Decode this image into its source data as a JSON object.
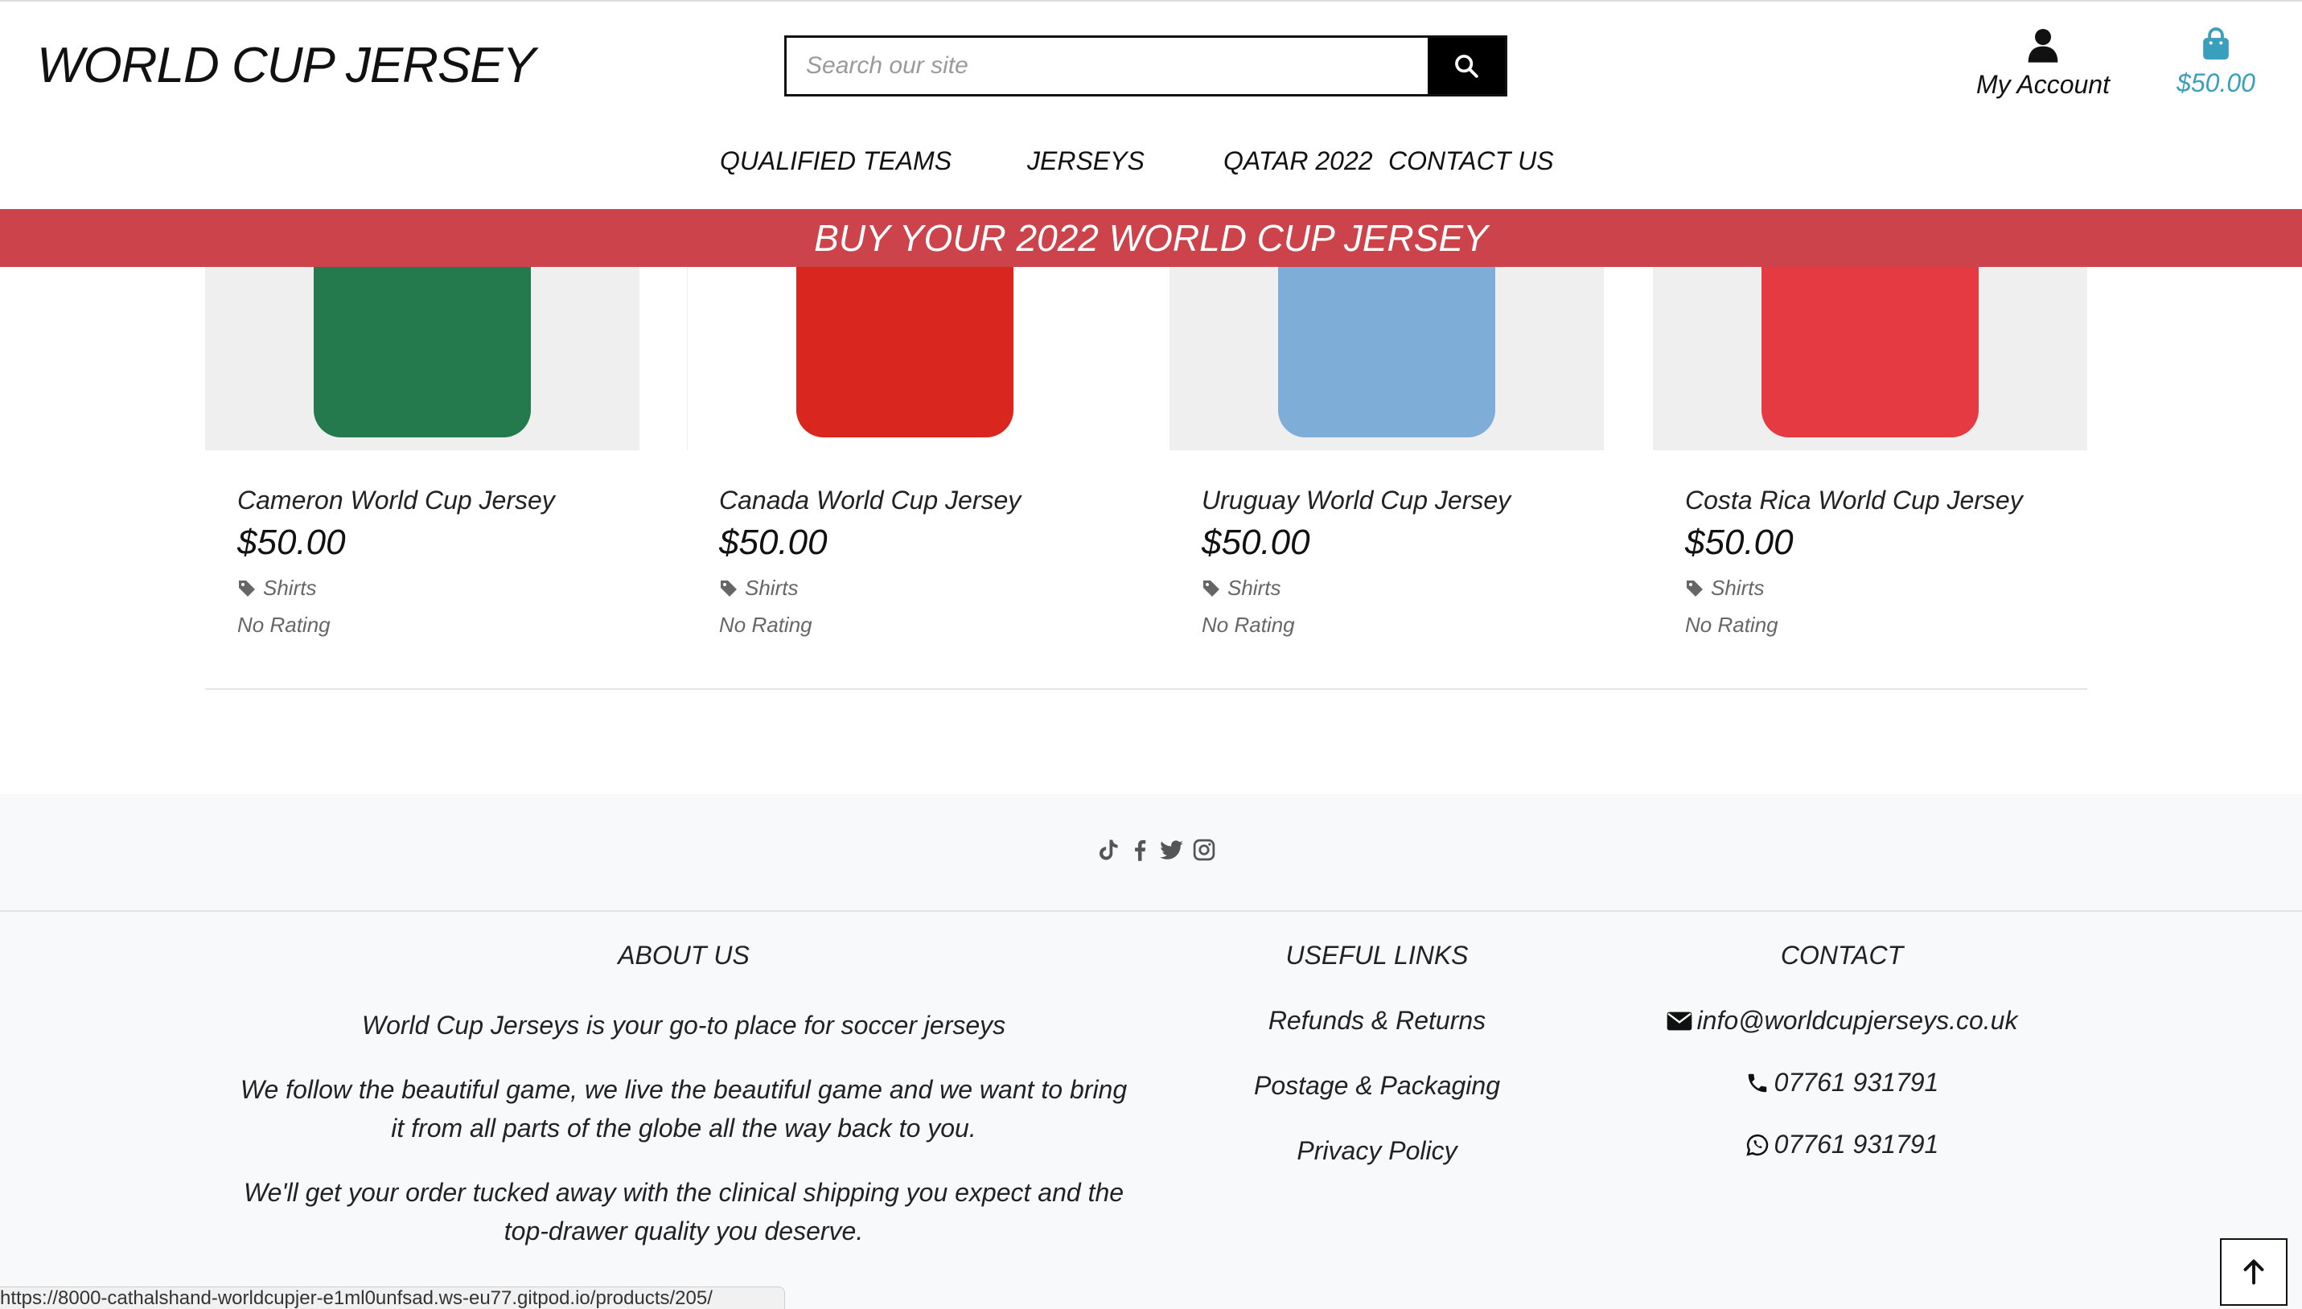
{
  "header": {
    "logo": "WORLD CUP JERSEY",
    "search_placeholder": "Search our site",
    "account_label": "My Account",
    "cart_total": "$50.00"
  },
  "nav": {
    "items": [
      "QUALIFIED TEAMS",
      "JERSEYS",
      "QATAR 2022",
      "CONTACT US"
    ]
  },
  "banner": {
    "text": "BUY YOUR 2022 WORLD CUP JERSEY"
  },
  "products": [
    {
      "name": "Cameron World Cup Jersey",
      "price": "$50.00",
      "category": "Shirts",
      "rating": "No Rating",
      "color": "#247a4d"
    },
    {
      "name": "Canada World Cup Jersey",
      "price": "$50.00",
      "category": "Shirts",
      "rating": "No Rating",
      "color": "#d9271f"
    },
    {
      "name": "Uruguay World Cup Jersey",
      "price": "$50.00",
      "category": "Shirts",
      "rating": "No Rating",
      "color": "#7eaed8"
    },
    {
      "name": "Costa Rica World Cup Jersey",
      "price": "$50.00",
      "category": "Shirts",
      "rating": "No Rating",
      "color": "#e53a41"
    }
  ],
  "footer": {
    "social_icons": [
      "tiktok-icon",
      "facebook-icon",
      "twitter-icon",
      "instagram-icon"
    ],
    "about": {
      "heading": "ABOUT US",
      "paragraphs": [
        "World Cup Jerseys is your go-to place for soccer jerseys",
        "We follow the beautiful game, we live the beautiful game and we want to bring it from all parts of the globe all the way back to you.",
        "We'll get your order tucked away with the clinical shipping you expect and the top-drawer quality you deserve."
      ]
    },
    "links": {
      "heading": "USEFUL LINKS",
      "items": [
        "Refunds & Returns",
        "Postage & Packaging",
        "Privacy Policy"
      ]
    },
    "contact": {
      "heading": "CONTACT",
      "email": "info@worldcupjerseys.co.uk",
      "phone": "07761 931791",
      "whatsapp": "07761 931791"
    }
  },
  "status_url": "https://8000-cathalshand-worldcupjer-e1ml0unfsad.ws-eu77.gitpod.io/products/205/"
}
